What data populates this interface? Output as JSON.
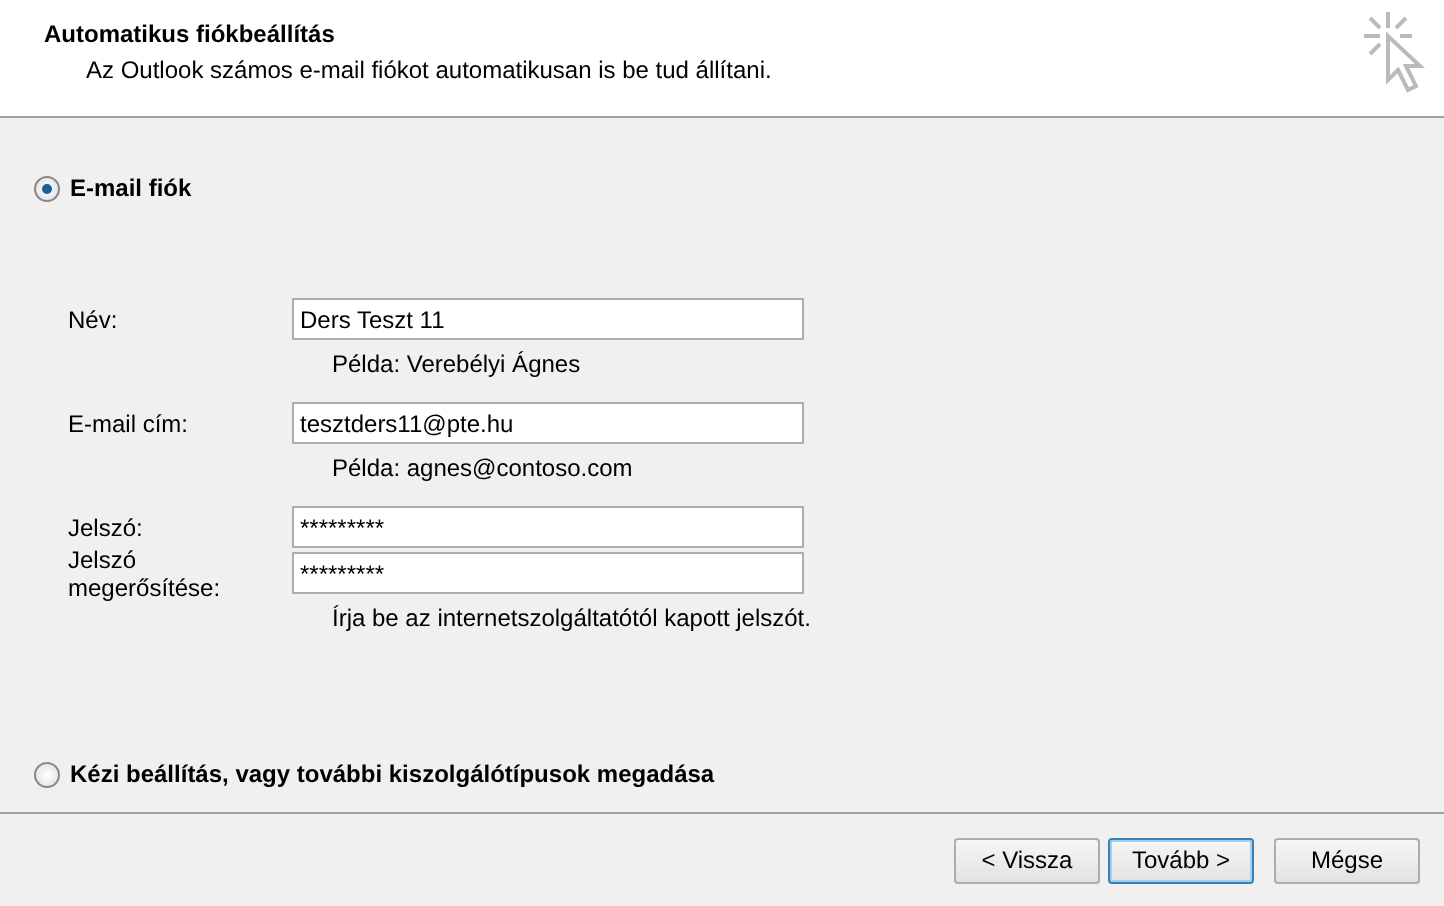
{
  "header": {
    "title": "Automatikus fiókbeállítás",
    "subtitle": "Az Outlook számos e-mail fiókot automatikusan is be tud állítani."
  },
  "options": [
    {
      "label": "E-mail fiók",
      "selected": true
    },
    {
      "label": "Kézi beállítás, vagy további kiszolgálótípusok megadása",
      "selected": false
    }
  ],
  "fields": [
    {
      "label": "Név:",
      "value": "Ders Teszt 11",
      "hint": "Példa: Verebélyi Ágnes"
    },
    {
      "label": "E-mail cím:",
      "value": "tesztders11@pte.hu",
      "hint": "Példa: agnes@contoso.com"
    },
    {
      "label": "Jelszó:",
      "value": "*********"
    },
    {
      "label": "Jelszó megerősítése:",
      "value": "*********",
      "hint": "Írja be az internetszolgáltatótól kapott jelszót."
    }
  ],
  "buttons": [
    {
      "label": "< Vissza",
      "default": false
    },
    {
      "label": "Tovább >",
      "default": true
    },
    {
      "label": "Mégse",
      "default": false
    }
  ]
}
